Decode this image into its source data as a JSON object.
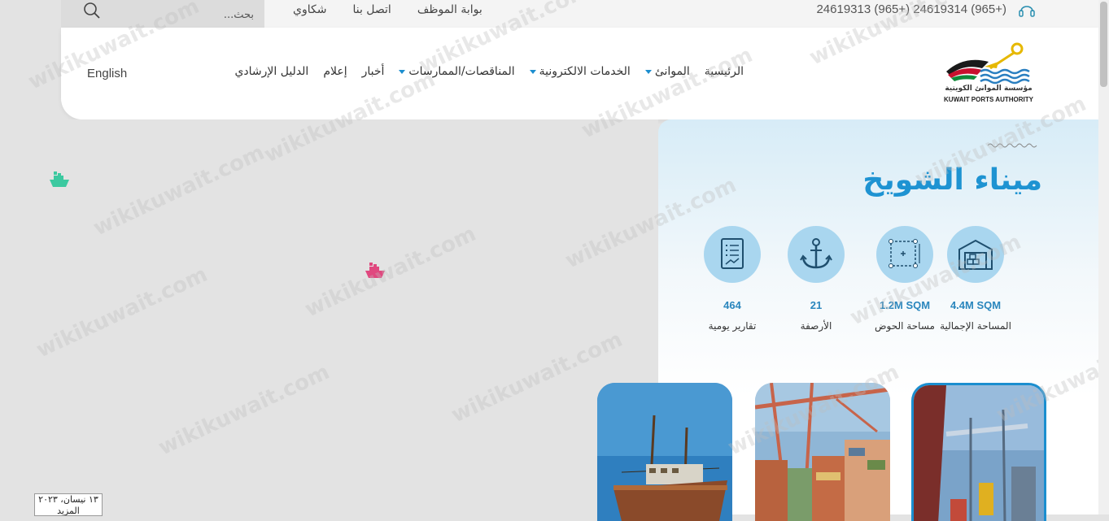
{
  "topbar": {
    "search_placeholder": "بحث...",
    "links": [
      "بوابة الموظف",
      "اتصل بنا",
      "شكاوي"
    ],
    "phones": "24619313 (965+) 24619314 (965+)"
  },
  "header": {
    "nav": [
      {
        "label": "الرئيسية",
        "dropdown": false
      },
      {
        "label": "الموانئ",
        "dropdown": true
      },
      {
        "label": "الخدمات الالكترونية",
        "dropdown": true
      },
      {
        "label": "المناقصات/الممارسات",
        "dropdown": true
      },
      {
        "label": "أخبار",
        "dropdown": false
      },
      {
        "label": "إعلام",
        "dropdown": false
      },
      {
        "label": "الدليل الإرشادي",
        "dropdown": false
      }
    ],
    "language": "English",
    "logo_ar": "مؤسسة الموانئ الكويتية",
    "logo_en": "KUWAIT PORTS AUTHORITY"
  },
  "map": {
    "date_label": "١٣ نيسان، ٢٠٢٣",
    "date_sub": "المزيد"
  },
  "port": {
    "title": "ميناء الشويخ",
    "stats": [
      {
        "value": "4.4M SQM",
        "label": "المساحة الإجمالية",
        "icon": "warehouse-icon"
      },
      {
        "value": "1.2M SQM",
        "label": "مساحة الحوض",
        "icon": "area-measure-icon"
      },
      {
        "value": "21",
        "label": "الأرصفة",
        "icon": "anchor-icon"
      },
      {
        "value": "464",
        "label": "تقارير يومية",
        "icon": "report-icon"
      }
    ]
  },
  "watermark": "wikikuwait.com",
  "colors": {
    "accent": "#1e93d2",
    "ship_green": "#3cc9a0",
    "ship_pink": "#e0487f",
    "stat_circle": "#a9d6ef"
  }
}
